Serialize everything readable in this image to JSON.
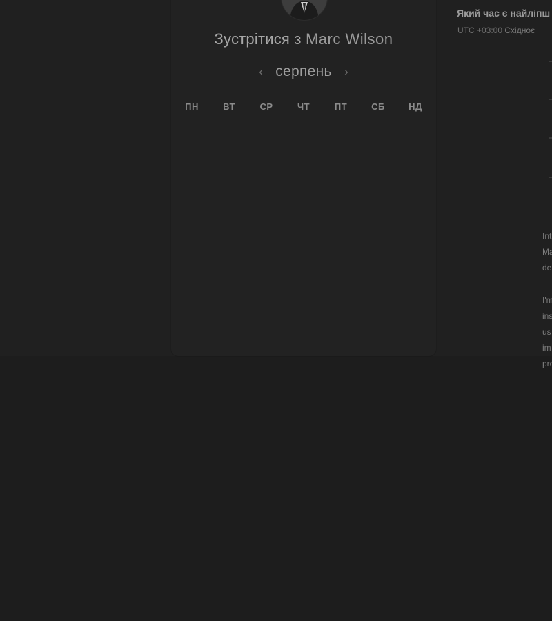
{
  "booking": {
    "title_prefix": "Зустрітися з",
    "host_name": "Marc Wilson",
    "month": "серпень",
    "weekdays": [
      "ПН",
      "ВТ",
      "СР",
      "ЧТ",
      "ПТ",
      "СБ",
      "НД"
    ]
  },
  "time_panel": {
    "title": "Який час є найліпш",
    "timezone_offset": "UTC +03:00",
    "timezone_name": "Східноє"
  },
  "description": {
    "paragraph1": [
      "Int",
      "Ma",
      "de"
    ],
    "paragraph2": [
      "I'm",
      "ins",
      "us",
      "im",
      "pro"
    ]
  },
  "icons": {
    "prev": "chevron-left-icon",
    "next": "chevron-right-icon"
  }
}
